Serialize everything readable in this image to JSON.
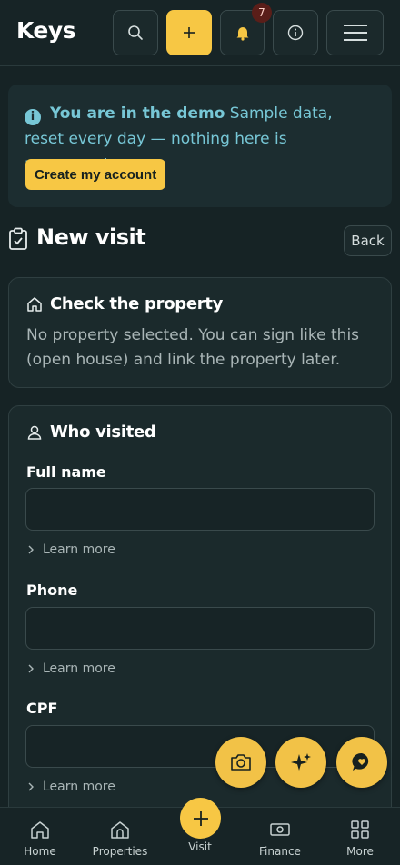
{
  "header": {
    "logo": "Keys",
    "notifications_count": "7"
  },
  "demo_banner": {
    "title": "You are in the demo",
    "message": "Sample data, reset every day — nothing here is permanent.",
    "create_button": "Create my account"
  },
  "page": {
    "title": "New visit",
    "back_button": "Back"
  },
  "property_card": {
    "title": "Check the property",
    "description": "No property selected. You can sign like this (open house) and link the property later."
  },
  "visitor_card": {
    "title": "Who visited",
    "fields": [
      {
        "label": "Full name",
        "value": "",
        "learn_more": "Learn more"
      },
      {
        "label": "Phone",
        "value": "",
        "learn_more": "Learn more"
      },
      {
        "label": "CPF",
        "value": "",
        "learn_more": "Learn more"
      }
    ]
  },
  "bottom_nav": {
    "items": [
      {
        "label": "Home",
        "icon": "home-icon"
      },
      {
        "label": "Properties",
        "icon": "properties-icon"
      },
      {
        "label": "Visit",
        "icon": "plus-icon"
      },
      {
        "label": "Finance",
        "icon": "cash-icon"
      },
      {
        "label": "More",
        "icon": "grid-icon"
      }
    ]
  },
  "colors": {
    "background": "#162325",
    "accent": "#f7c744",
    "info": "#77c7d6"
  }
}
